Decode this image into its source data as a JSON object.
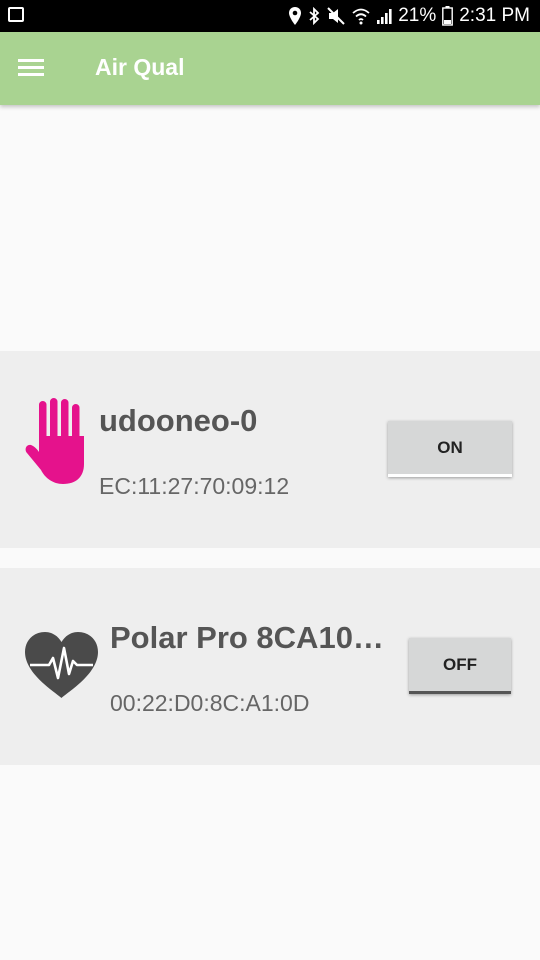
{
  "status_bar": {
    "battery_percent": "21%",
    "time": "2:31 PM",
    "icons": [
      "gallery-icon",
      "location-icon",
      "bluetooth-icon",
      "mute-icon",
      "wifi-icon",
      "signal-icon",
      "battery-icon"
    ]
  },
  "toolbar": {
    "title": "Air Qual",
    "menu_icon": "menu-icon",
    "color": "#a9d391"
  },
  "devices": [
    {
      "icon": "hand-icon",
      "icon_color": "#e5128c",
      "name": "udooneo-0",
      "mac": "EC:11:27:70:09:12",
      "toggle_label": "ON"
    },
    {
      "icon": "heart-rate-icon",
      "icon_color": "#4a4a4a",
      "name": "Polar Pro 8CA10…",
      "mac": "00:22:D0:8C:A1:0D",
      "toggle_label": "OFF"
    }
  ]
}
